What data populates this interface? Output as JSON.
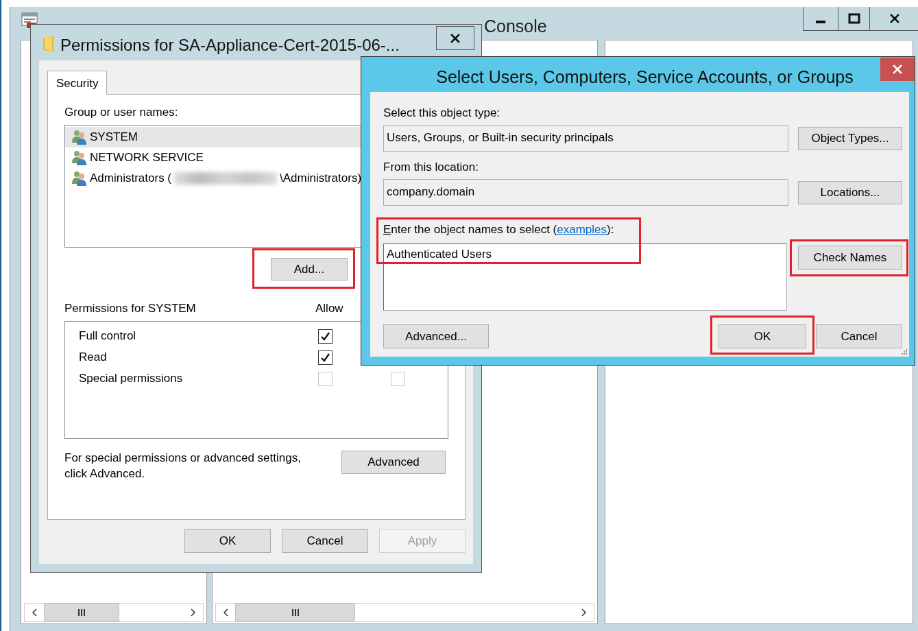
{
  "console": {
    "title": "Console"
  },
  "permissions_dialog": {
    "title": "Permissions for SA-Appliance-Cert-2015-06-...",
    "tabs": [
      {
        "label": "Security",
        "selected": true
      }
    ],
    "group_label": "Group or user names:",
    "principals": [
      {
        "name": "SYSTEM",
        "selected": true
      },
      {
        "name": "NETWORK SERVICE",
        "selected": false
      },
      {
        "name": "Administrators (",
        "redacted": true,
        "name_end": "\\Administrators)",
        "selected": false
      }
    ],
    "add_button": {
      "label": "Add...",
      "highlighted": true
    },
    "permissions_label": "Permissions for SYSTEM",
    "allow_header": "Allow",
    "permissions": [
      {
        "name": "Full control",
        "allow": {
          "checked": true,
          "disabled": false
        }
      },
      {
        "name": "Read",
        "allow": {
          "checked": true,
          "disabled": false
        }
      },
      {
        "name": "Special permissions",
        "allow": {
          "checked": false,
          "disabled": true
        },
        "deny": {
          "checked": false,
          "disabled": true
        }
      }
    ],
    "advanced_note": "For special permissions or advanced settings, click Advanced.",
    "advanced_button": {
      "label": "Advanced"
    },
    "buttons": [
      {
        "label": "OK",
        "disabled": false
      },
      {
        "label": "Cancel",
        "disabled": false
      },
      {
        "label": "Apply",
        "disabled": true
      }
    ]
  },
  "select_dialog": {
    "title": "Select Users, Computers, Service Accounts, or Groups",
    "object_type_label": "Select this object type:",
    "object_type": "Users, Groups, or Built-in security principals",
    "object_types_button": {
      "label": "Object Types..."
    },
    "location_label": "From this location:",
    "location": "company.domain",
    "locations_button": {
      "label": "Locations..."
    },
    "names_label": {
      "before": "Enter the object names to select (",
      "link": "examples",
      "after": "):",
      "highlighted": true
    },
    "names_value": "Authenticated Users",
    "check_names_button": {
      "label": "Check Names",
      "highlighted": true
    },
    "advanced_button": {
      "label": "Advanced..."
    },
    "buttons": [
      {
        "label": "OK",
        "highlighted": true
      },
      {
        "label": "Cancel"
      }
    ]
  }
}
